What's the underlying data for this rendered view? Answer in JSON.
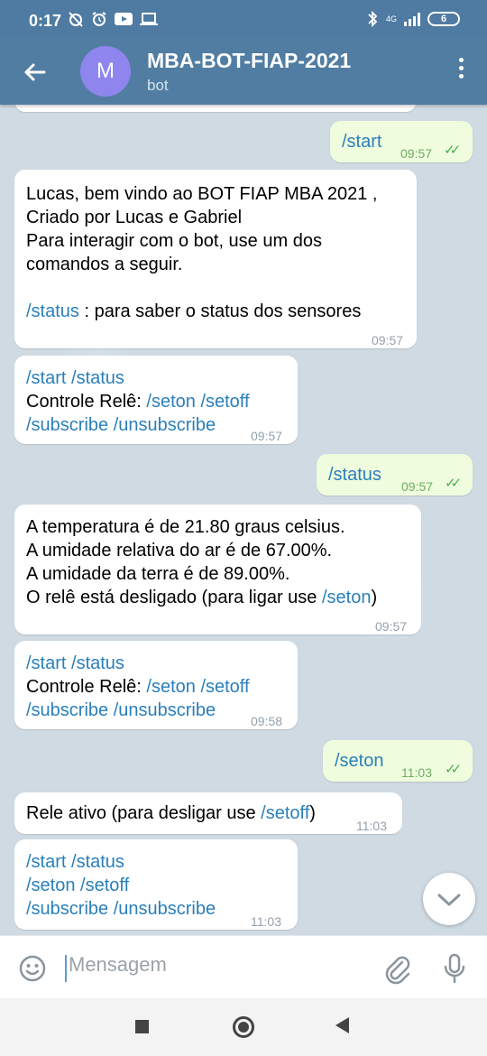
{
  "status_bar": {
    "time": "0:17",
    "network": "4G",
    "battery": "6"
  },
  "header": {
    "avatar_letter": "M",
    "title": "MBA-BOT-FIAP-2021",
    "subtitle": "bot"
  },
  "messages": [
    {
      "dir": "out",
      "text": "/start",
      "time": "09:57"
    },
    {
      "dir": "in",
      "lines": [
        "Lucas, bem vindo ao BOT FIAP MBA 2021 ,",
        "Criado por Lucas e Gabriel",
        "Para interagir com o bot, use um dos",
        "comandos a seguir."
      ],
      "cmd": "/status",
      "cmd_desc": " : para saber o status dos sensores",
      "time": "09:57"
    },
    {
      "dir": "in",
      "line1": "/start /status",
      "line2_prefix": "Controle Relê: ",
      "line2_cmds": "/seton /setoff",
      "line3": "/subscribe /unsubscribe",
      "time": "09:57"
    },
    {
      "dir": "out",
      "text": "/status",
      "time": "09:57"
    },
    {
      "dir": "in",
      "lines": [
        "A temperatura é de 21.80 graus celsius.",
        "A umidade relativa do ar é de 67.00%.",
        "A umidade da terra é de 89.00%."
      ],
      "last_prefix": "O relê está desligado (para ligar use ",
      "last_cmd": "/seton",
      "last_suffix": ")",
      "time": "09:57"
    },
    {
      "dir": "in",
      "line1": "/start /status",
      "line2_prefix": "Controle Relê: ",
      "line2_cmds": "/seton /setoff",
      "line3": "/subscribe /unsubscribe",
      "time": "09:58"
    },
    {
      "dir": "out",
      "text": "/seton",
      "time": "11:03"
    },
    {
      "dir": "in",
      "prefix": "Rele ativo (para desligar use ",
      "cmd": "/setoff",
      "suffix": ")",
      "time": "11:03"
    },
    {
      "dir": "in",
      "line1": "/start /status",
      "line2": "/seton /setoff",
      "line3": "/subscribe /unsubscribe",
      "time": "11:03"
    }
  ],
  "input": {
    "placeholder": "Mensagem"
  },
  "colors": {
    "header": "#517da2",
    "status_bar": "#4f7ba2",
    "chat_bg": "#cfdae3",
    "bubble_in": "#ffffff",
    "bubble_out": "#effdde",
    "link": "#2a7fbb"
  }
}
